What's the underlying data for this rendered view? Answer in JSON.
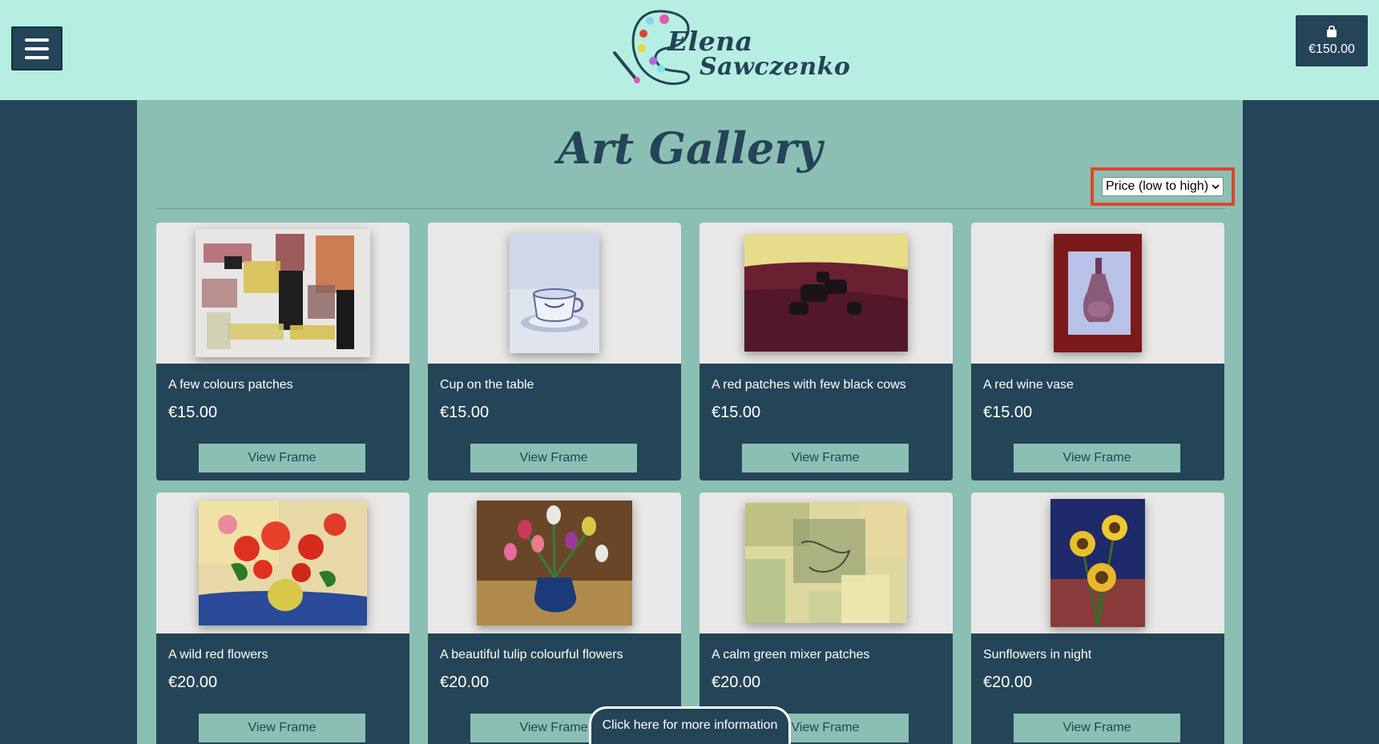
{
  "header": {
    "logo_line1": "Elena",
    "logo_line2": "Sawczenko",
    "cart_total": "€150.00"
  },
  "main": {
    "title": "Art Gallery",
    "sort": {
      "selected": "Price (low to high)"
    }
  },
  "products": [
    {
      "title": "A few colours patches",
      "price": "€15.00",
      "button": "View Frame"
    },
    {
      "title": "Cup on the table",
      "price": "€15.00",
      "button": "View Frame"
    },
    {
      "title": "A red patches with few black cows",
      "price": "€15.00",
      "button": "View Frame"
    },
    {
      "title": "A red wine vase",
      "price": "€15.00",
      "button": "View Frame"
    },
    {
      "title": "A wild red flowers",
      "price": "€20.00",
      "button": "View Frame"
    },
    {
      "title": "A beautiful tulip colourful flowers",
      "price": "€20.00",
      "button": "View Frame"
    },
    {
      "title": "A calm green mixer patches",
      "price": "€20.00",
      "button": "View Frame"
    },
    {
      "title": "Sunflowers in night",
      "price": "€20.00",
      "button": "View Frame"
    }
  ],
  "info_button": "Click here for more information",
  "icons": {
    "menu": "hamburger-icon",
    "cart": "shopping-bag-icon",
    "sort_caret": "chevron-down-icon"
  },
  "colors": {
    "header_bg": "#b6efe1",
    "page_bg": "#244457",
    "panel_bg": "#8bbfb4",
    "highlight": "#e0452b"
  }
}
